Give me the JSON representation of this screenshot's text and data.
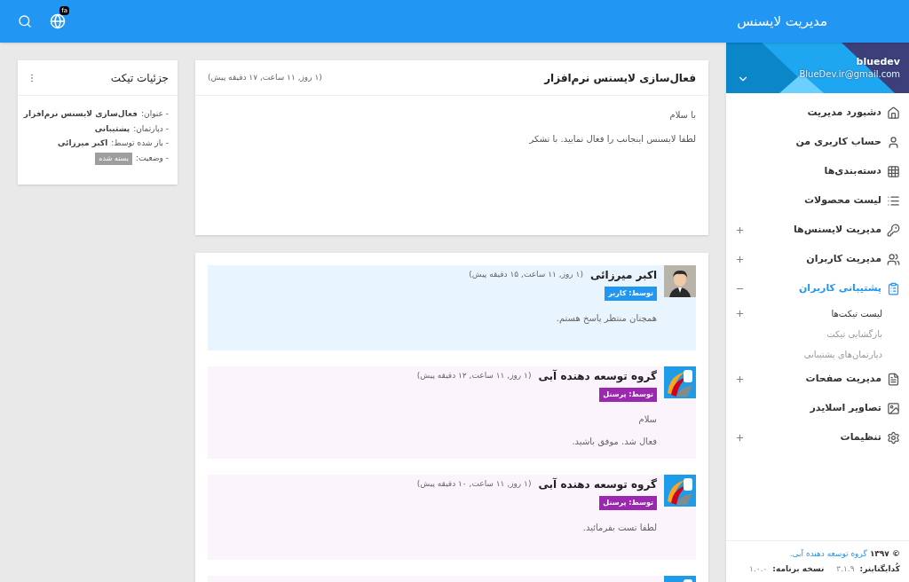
{
  "topbar": {
    "title": "مدیریت لایسنس",
    "language_badge": "fa"
  },
  "sidebar": {
    "user": {
      "name": "bluedev",
      "email": "BlueDev.ir@gmail.com"
    },
    "items": [
      {
        "label": "دشبورد مدیریت",
        "expandable": false,
        "expanded": false,
        "selected": false
      },
      {
        "label": "حساب کاربری من",
        "expandable": false,
        "expanded": false,
        "selected": false
      },
      {
        "label": "دسته‌بندی‌ها",
        "expandable": false,
        "expanded": false,
        "selected": false
      },
      {
        "label": "لیست محصولات",
        "expandable": false,
        "expanded": false,
        "selected": false
      },
      {
        "label": "مدیریت لایسنس‌ها",
        "expandable": true,
        "expanded": false,
        "selected": false
      },
      {
        "label": "مدیریت کاربران",
        "expandable": true,
        "expanded": false,
        "selected": false
      },
      {
        "label": "پشتیبانی کاربران",
        "expandable": true,
        "expanded": true,
        "selected": true,
        "children": [
          {
            "label": "لیست تیکت‌ها",
            "expandable": true,
            "selected": true
          },
          {
            "label": "بازگشایی تیکت",
            "expandable": false,
            "selected": false
          },
          {
            "label": "دپارتمان‌های پشتیبانی",
            "expandable": false,
            "selected": false
          }
        ]
      },
      {
        "label": "مدیریت صفحات",
        "expandable": true,
        "expanded": false,
        "selected": false
      },
      {
        "label": "تصاویر اسلایدر",
        "expandable": false,
        "expanded": false,
        "selected": false
      },
      {
        "label": "تنظیمات",
        "expandable": true,
        "expanded": false,
        "selected": false
      }
    ],
    "footer": {
      "copyright_prefix": "© ۱۳۹۷",
      "copyright_link": "گروه توسعه دهنده آبی.",
      "coder_label": "کُدایگناینر:",
      "coder_version": "۳.۱.۹",
      "app_label": "نسخه برنامه:",
      "app_version": "۱.۰.۰"
    }
  },
  "ticket": {
    "title": "فعال‌سازی لایسنس نرم‌افزار",
    "time": "(۱ روز, ۱۱ ساعت, ۱۷ دقیقه پیش)",
    "body": [
      "با سلام",
      "لطفا لایسنس اینجانب را فعال نمایید. با تشکر"
    ]
  },
  "replies": [
    {
      "kind": "user",
      "author": "اکبر میرزائی",
      "time": "(۱ روز, ۱۱ ساعت, ۱۵ دقیقه پیش)",
      "badge": "توسط: کاربر",
      "body": [
        "همچنان منتظر پاسخ هستم."
      ]
    },
    {
      "kind": "staff",
      "author": "گروه توسعه دهنده آبی",
      "time": "(۱ روز, ۱۱ ساعت, ۱۲ دقیقه پیش)",
      "badge": "توسط: پرسنل",
      "body": [
        "سلام",
        "فعال شد. موفق باشید."
      ]
    },
    {
      "kind": "staff",
      "author": "گروه توسعه دهنده آبی",
      "time": "(۱ روز, ۱۱ ساعت, ۱۰ دقیقه پیش)",
      "badge": "توسط: پرسنل",
      "body": [
        "لطفا تست بفرمائید."
      ]
    },
    {
      "kind": "staff"
    }
  ],
  "details": {
    "title": "جزئیات تیکت",
    "rows": [
      {
        "label": "- عنوان:",
        "value": "فعال‌سازی لایسنس نرم‌افزار"
      },
      {
        "label": "- دپارتمان:",
        "value": "پشتیبانی"
      },
      {
        "label": "- باز شده توسط:",
        "value": "اکبر میرزائی"
      },
      {
        "label": "- وضعیت:",
        "value": "بسته شده",
        "kind": "badge"
      }
    ]
  }
}
